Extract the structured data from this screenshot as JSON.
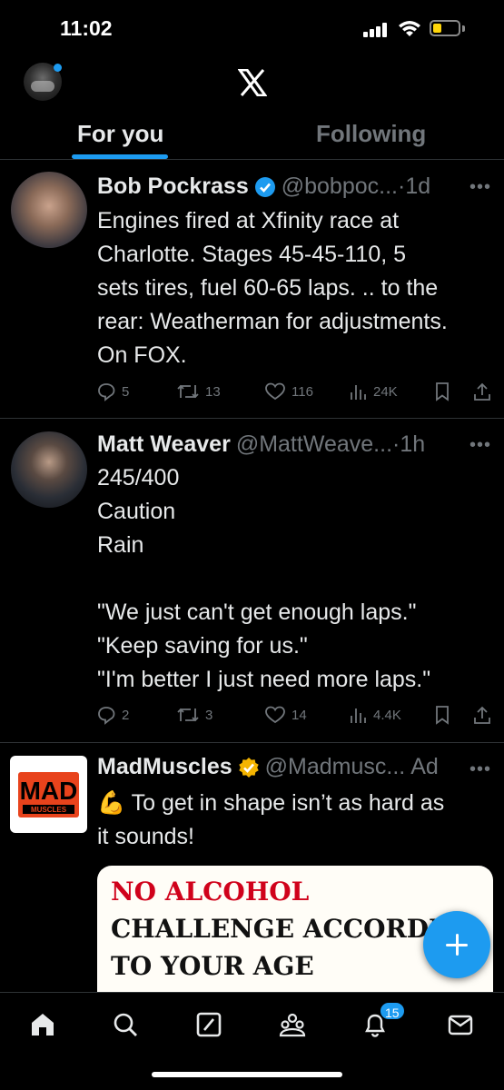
{
  "status_bar": {
    "time": "11:02"
  },
  "header": {
    "logo": "x-logo"
  },
  "tabs": [
    {
      "label": "For you",
      "active": true
    },
    {
      "label": "Following",
      "active": false
    }
  ],
  "tweets": [
    {
      "name": "Bob Pockrass",
      "handle": "@bobpoc...",
      "time": "·1d",
      "verified": "blue",
      "body": "Engines fired at Xfinity race at\nCharlotte. Stages 45-45-110, 5\nsets tires, fuel 60-65 laps. .. to the\nrear: Weatherman for adjustments.\nOn FOX.",
      "replies": "5",
      "retweets": "13",
      "likes": "116",
      "views": "24K"
    },
    {
      "name": "Matt Weaver",
      "handle": "@MattWeave...",
      "time": "·1h",
      "verified": "none",
      "body": "245/400\nCaution\nRain\n\n\"We just can't get enough laps.\"\n\"Keep saving for us.\"\n\"I'm better I just need more laps.\"",
      "replies": "2",
      "retweets": "3",
      "likes": "14",
      "views": "4.4K"
    }
  ],
  "ad": {
    "name": "MadMuscles",
    "handle": "@Madmusc...",
    "label": "Ad",
    "verified": "gold",
    "emoji": "💪",
    "body": " To get in shape isn’t as hard as\nit sounds!",
    "logo_text_top": "MAD",
    "logo_text_bottom": "MUSCLES",
    "card_lines": [
      "NO ALCOHOL",
      "CHALLENGE ACCORDI",
      "TO YOUR AGE"
    ],
    "card_red": "#d0021b"
  },
  "bottom_nav": {
    "items": [
      "home-icon",
      "search-icon",
      "grok-icon",
      "communities-icon",
      "notifications-icon",
      "messages-icon"
    ],
    "notification_count": "15"
  },
  "colors": {
    "accent": "#1d9bf0",
    "muted": "#71767b",
    "text": "#e7e9ea",
    "gold": "#f4b400"
  }
}
